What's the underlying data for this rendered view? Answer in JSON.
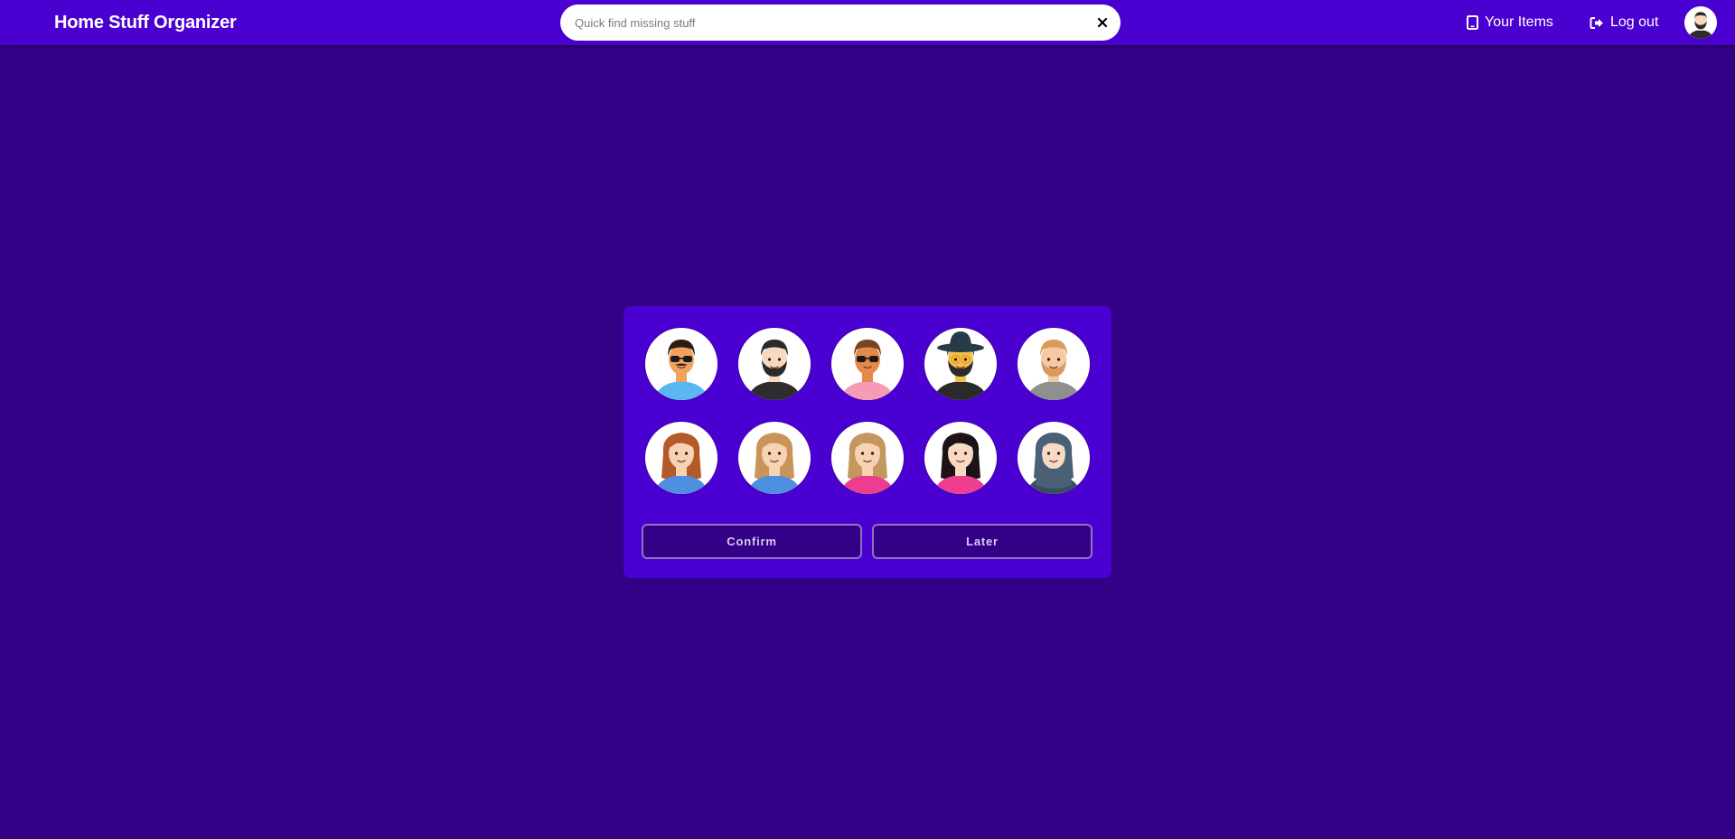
{
  "header": {
    "brand": "Home Stuff Organizer",
    "search": {
      "placeholder": "Quick find missing stuff",
      "value": ""
    },
    "links": {
      "items": "Your Items",
      "logout": "Log out"
    }
  },
  "picker": {
    "avatars": [
      {
        "icon": "avatar-man-sunglasses-mustache-icon",
        "skin": "#f0a35e",
        "hair": "#2b1d14",
        "shirt": "#5bb7f2"
      },
      {
        "icon": "avatar-man-beard-black-shirt-icon",
        "skin": "#f7d9bf",
        "hair": "#2b2b2b",
        "shirt": "#2d2d2d"
      },
      {
        "icon": "avatar-man-sunglasses-pink-shirt-icon",
        "skin": "#e3894a",
        "hair": "#7a4420",
        "shirt": "#f59bb5"
      },
      {
        "icon": "avatar-man-hat-glasses-icon",
        "skin": "#f2c04a",
        "hair": "#263b47",
        "shirt": "#2a2a2a"
      },
      {
        "icon": "avatar-man-blond-beard-icon",
        "skin": "#f4c9a4",
        "hair": "#d99a5b",
        "shirt": "#8f8f8f"
      },
      {
        "icon": "avatar-woman-brown-hair-icon",
        "skin": "#f7d2b4",
        "hair": "#b45a28",
        "shirt": "#4f8fe0"
      },
      {
        "icon": "avatar-woman-curly-blonde-icon",
        "skin": "#f7d2b4",
        "hair": "#c8945a",
        "shirt": "#4f8fe0"
      },
      {
        "icon": "avatar-woman-bob-pink-shirt-icon",
        "skin": "#f7d2b4",
        "hair": "#c49660",
        "shirt": "#ee3d8f"
      },
      {
        "icon": "avatar-woman-black-hair-icon",
        "skin": "#f7d9c4",
        "hair": "#1c1316",
        "shirt": "#ee3d8f"
      },
      {
        "icon": "avatar-woman-hijab-icon",
        "skin": "#f7d9c4",
        "hair": "#4a6076",
        "shirt": "#3a4d60"
      }
    ],
    "confirm_label": "Confirm",
    "later_label": "Later"
  },
  "colors": {
    "background": "#330088",
    "navbar": "#4b00d2",
    "card": "#4b00d2",
    "button_bg": "#330088",
    "button_text": "#d6ccf2"
  }
}
